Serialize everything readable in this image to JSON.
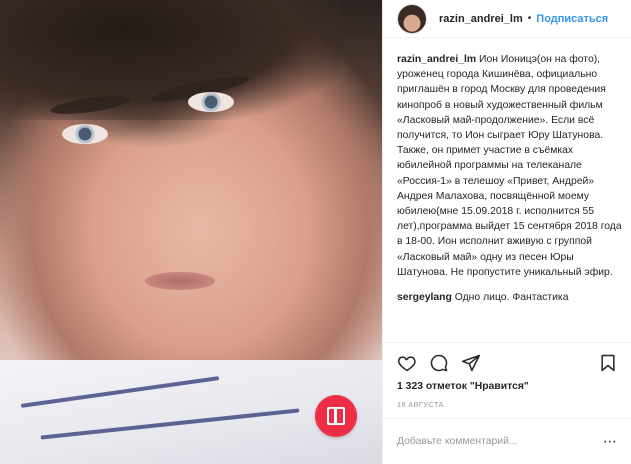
{
  "post": {
    "username": "razin_andrei_lm",
    "separator": "•",
    "follow_label": "Подписаться",
    "caption_user": "razin_andrei_lm",
    "caption_text": "Ион Ионицэ(он на фото), уроженец города Кишинёва, официально приглашён в город Москву для проведения кинопроб в новый художественный фильм «Ласковый май-продолжение». Если всё получится, то Ион сыграет Юру Шатунова. Также, он примет участие в съёмках юбилейной программы на телеканале «Россия-1» в телешоу «Привет, Андрей» Андрея Малахова, посвящённой моему юбилею(мне 15.09.2018 г. исполнится 55 лет),программа выйдет 15 сентября 2018 года в 18-00. Ион исполнит вживую с группой «Ласковый май» одну из песен Юры Шатунова. Не пропустите уникальный эфир.",
    "comments": [
      {
        "user": "sergeylang",
        "text": "Одно лицо. Фантастика"
      }
    ],
    "likes_text": "1 323 отметок \"Нравится\"",
    "date_text": "18 августа",
    "add_comment_placeholder": "Добавьте комментарий...",
    "icons": [
      "heart-icon",
      "comment-icon",
      "share-icon",
      "bookmark-icon",
      "carousel-icon"
    ],
    "accent_color": "#3897f0",
    "badge_color": "#ee2e45"
  }
}
